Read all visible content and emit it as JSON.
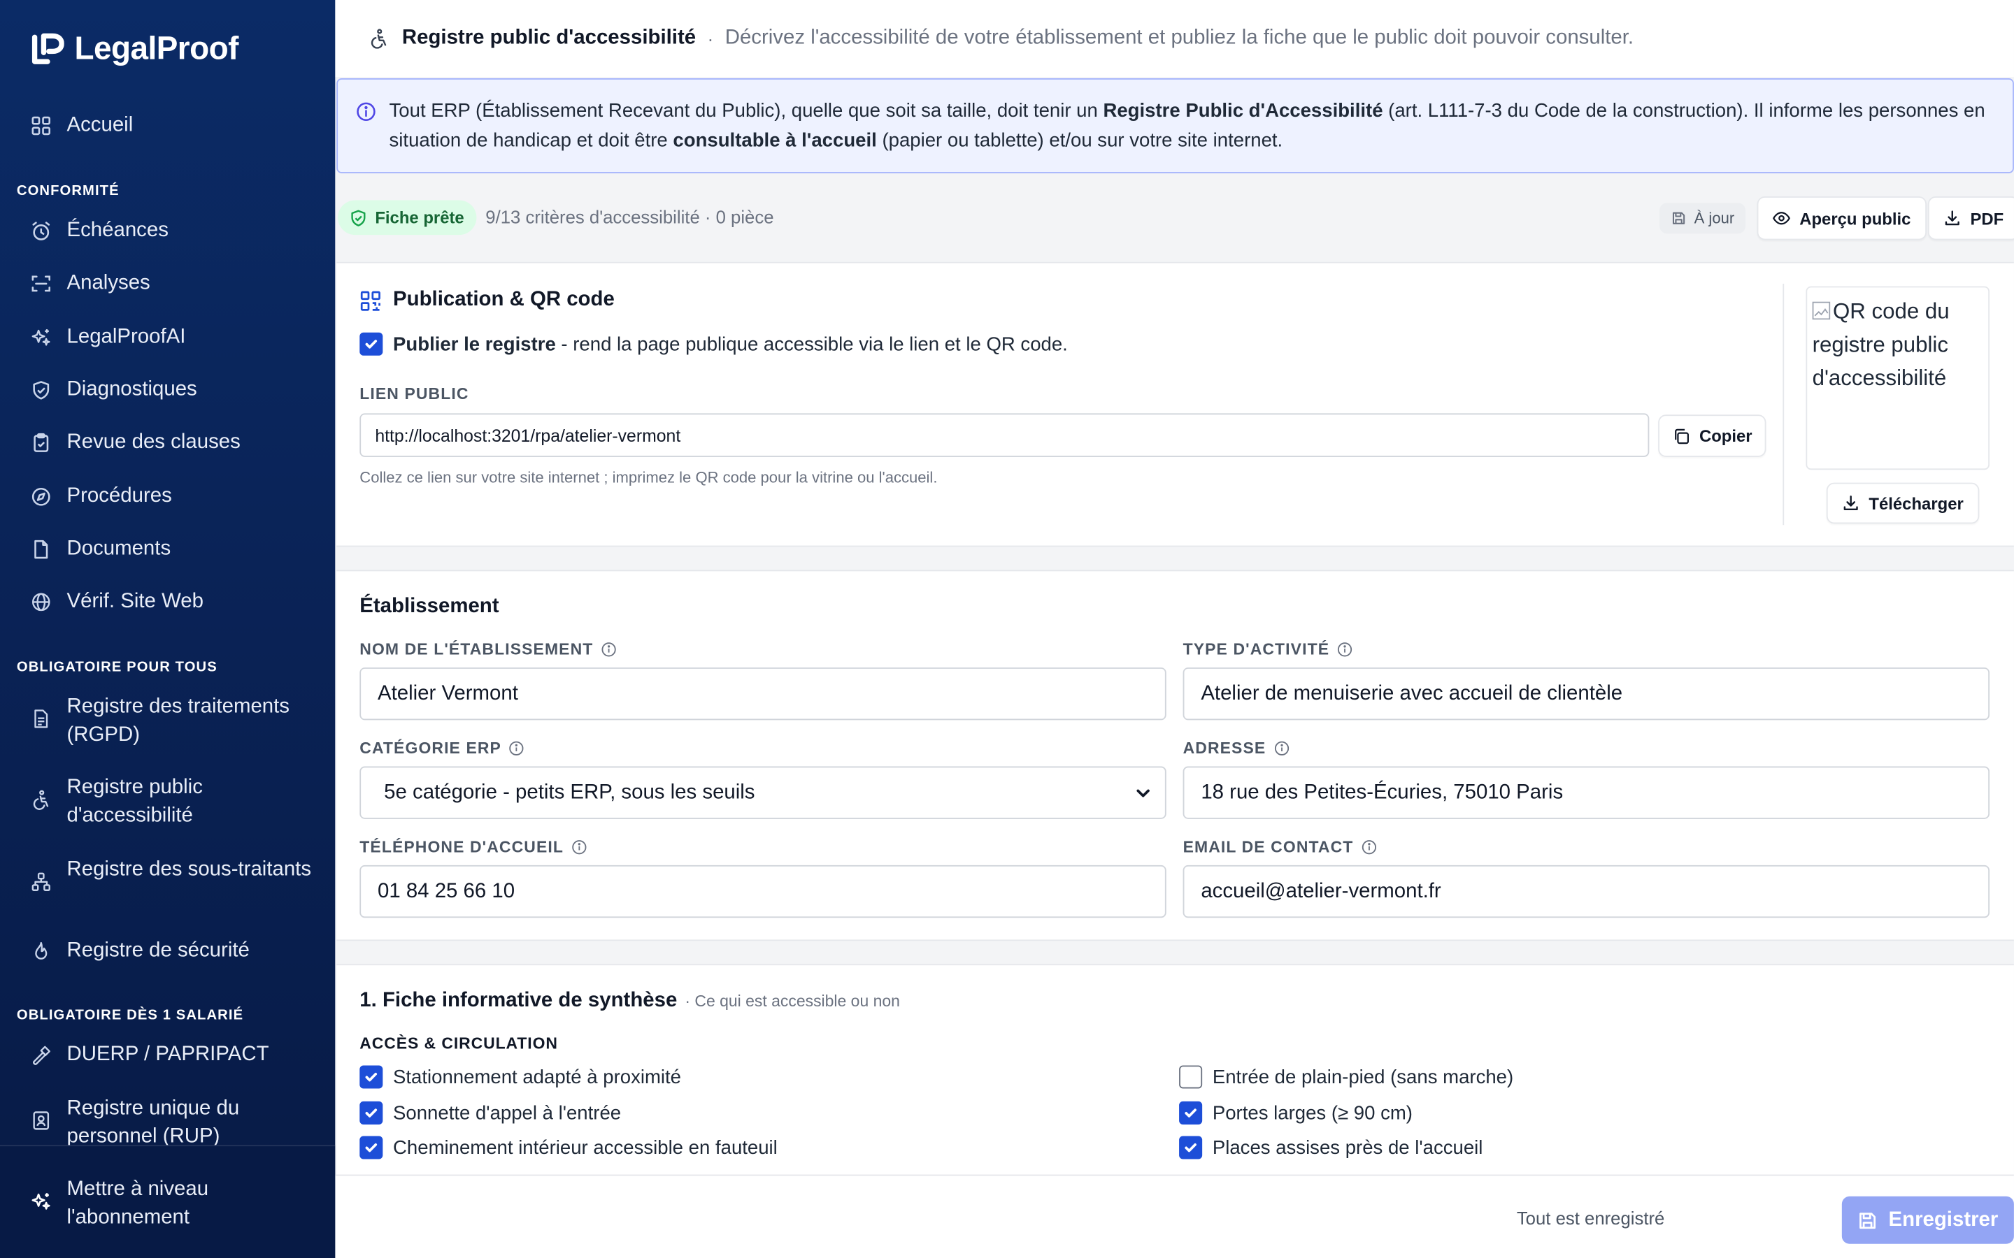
{
  "app": {
    "name": "LegalProof",
    "colors": {
      "sidebar": "#0b2b66",
      "accent": "#1d4ed8",
      "success_bg": "#dcfce7",
      "success_text": "#166534",
      "save_button": "#93a5f4"
    }
  },
  "sidebar": {
    "home": {
      "label": "Accueil",
      "icon": "grid-icon"
    },
    "sections": [
      {
        "label": "CONFORMITÉ"
      },
      {
        "label": "OBLIGATOIRE POUR TOUS"
      },
      {
        "label": "OBLIGATOIRE DÈS 1 SALARIÉ"
      }
    ],
    "items": [
      {
        "label": "Échéances",
        "icon": "alarm-clock-icon"
      },
      {
        "label": "Analyses",
        "icon": "scan-icon"
      },
      {
        "label": "LegalProofAI",
        "icon": "sparkles-icon"
      },
      {
        "label": "Diagnostiques",
        "icon": "shield-check-icon"
      },
      {
        "label": "Revue des clauses",
        "icon": "clipboard-check-icon"
      },
      {
        "label": "Procédures",
        "icon": "compass-icon"
      },
      {
        "label": "Documents",
        "icon": "file-icon"
      },
      {
        "label": "Vérif. Site Web",
        "icon": "globe-icon"
      },
      {
        "label": "Registre des traitements (RGPD)",
        "icon": "file-text-icon"
      },
      {
        "label": "Registre public d'accessibilité",
        "icon": "accessibility-icon"
      },
      {
        "label": "Registre des sous-traitants",
        "icon": "network-icon"
      },
      {
        "label": "Registre de sécurité",
        "icon": "flame-icon"
      },
      {
        "label": "DUERP / PAPRIPACT",
        "icon": "hammer-icon"
      },
      {
        "label": "Registre unique du personnel (RUP)",
        "icon": "id-badge-icon"
      }
    ],
    "upgrade": {
      "label": "Mettre à niveau l'abonnement",
      "icon": "sparkles-icon"
    }
  },
  "header": {
    "title": "Registre public d'accessibilité",
    "separator": "·",
    "subtitle": "Décrivez l'accessibilité de votre établissement et publiez la fiche que le public doit pouvoir consulter."
  },
  "banner": {
    "part1": "Tout ERP (Établissement Recevant du Public), quelle que soit sa taille, doit tenir un ",
    "bold1": "Registre Public d'Accessibilité",
    "part2": " (art. L111-7-3 du Code de la construction). Il informe les personnes en situation de handicap et doit être ",
    "bold2": "consultable à l'accueil",
    "part3": " (papier ou tablette) et/ou sur votre site internet."
  },
  "status": {
    "badge": "Fiche prête",
    "criteria": "9/13 critères d'accessibilité · 0 pièce",
    "uptodate": "À jour",
    "preview_label": "Aperçu public",
    "pdf_label": "PDF"
  },
  "publication": {
    "title": "Publication & QR code",
    "publish_bold": "Publier le registre",
    "publish_rest": " - rend la page publique accessible via le lien et le QR code.",
    "publish_checked": true,
    "link_label": "LIEN PUBLIC",
    "link_value": "http://localhost:3201/rpa/atelier-vermont",
    "copy_label": "Copier",
    "hint": "Collez ce lien sur votre site internet ; imprimez le QR code pour la vitrine ou l'accueil.",
    "qr_alt": "QR code du registre public d'accessibilité",
    "download_label": "Télécharger"
  },
  "etablissement": {
    "title": "Établissement",
    "fields": {
      "name": {
        "label": "NOM DE L'ÉTABLISSEMENT",
        "value": "Atelier Vermont"
      },
      "activity": {
        "label": "TYPE D'ACTIVITÉ",
        "value": "Atelier de menuiserie avec accueil de clientèle"
      },
      "category": {
        "label": "CATÉGORIE ERP",
        "value": "5e catégorie - petits ERP, sous les seuils"
      },
      "address": {
        "label": "ADRESSE",
        "value": "18 rue des Petites-Écuries, 75010 Paris"
      },
      "phone": {
        "label": "TÉLÉPHONE D'ACCUEIL",
        "value": "01 84 25 66 10"
      },
      "email": {
        "label": "EMAIL DE CONTACT",
        "value": "accueil@atelier-vermont.fr"
      }
    }
  },
  "fiche": {
    "title": "1. Fiche informative de synthèse",
    "subtitle": "· Ce qui est accessible ou non",
    "group": "ACCÈS & CIRCULATION",
    "criteria": [
      {
        "label": "Stationnement adapté à proximité",
        "checked": true
      },
      {
        "label": "Entrée de plain-pied (sans marche)",
        "checked": false
      },
      {
        "label": "Sonnette d'appel à l'entrée",
        "checked": true
      },
      {
        "label": "Portes larges (≥ 90 cm)",
        "checked": true
      },
      {
        "label": "Cheminement intérieur accessible en fauteuil",
        "checked": true
      },
      {
        "label": "Places assises près de l'accueil",
        "checked": true
      }
    ]
  },
  "footer": {
    "saved": "Tout est enregistré",
    "save_label": "Enregistrer"
  }
}
